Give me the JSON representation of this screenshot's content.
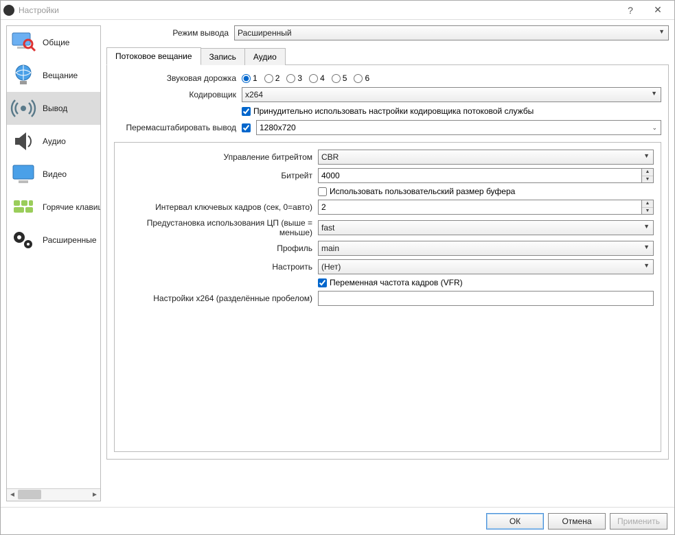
{
  "window": {
    "title": "Настройки"
  },
  "sidebar": {
    "items": [
      {
        "label": "Общие"
      },
      {
        "label": "Вещание"
      },
      {
        "label": "Вывод"
      },
      {
        "label": "Аудио"
      },
      {
        "label": "Видео"
      },
      {
        "label": "Горячие клавиши"
      },
      {
        "label": "Расширенные"
      }
    ]
  },
  "output_mode": {
    "label": "Режим вывода",
    "value": "Расширенный"
  },
  "tabs": {
    "streaming": "Потоковое вещание",
    "recording": "Запись",
    "audio": "Аудио"
  },
  "stream": {
    "audio_track_label": "Звуковая дорожка",
    "tracks": [
      "1",
      "2",
      "3",
      "4",
      "5",
      "6"
    ],
    "encoder_label": "Кодировщик",
    "encoder_value": "x264",
    "enforce_label": "Принудительно использовать настройки кодировщика потоковой службы",
    "rescale_label": "Перемасштабировать вывод",
    "rescale_value": "1280x720"
  },
  "x264": {
    "rate_control_label": "Управление битрейтом",
    "rate_control_value": "CBR",
    "bitrate_label": "Битрейт",
    "bitrate_value": "4000",
    "custom_buffer_label": "Использовать пользовательский размер буфера",
    "keyint_label": "Интервал ключевых кадров (сек, 0=авто)",
    "keyint_value": "2",
    "preset_label": "Предустановка использования ЦП (выше = меньше)",
    "preset_value": "fast",
    "profile_label": "Профиль",
    "profile_value": "main",
    "tune_label": "Настроить",
    "tune_value": "(Нет)",
    "vfr_label": "Переменная частота кадров (VFR)",
    "x264opts_label": "Настройки x264 (разделённые пробелом)",
    "x264opts_value": ""
  },
  "footer": {
    "ok": "ОК",
    "cancel": "Отмена",
    "apply": "Применить"
  }
}
